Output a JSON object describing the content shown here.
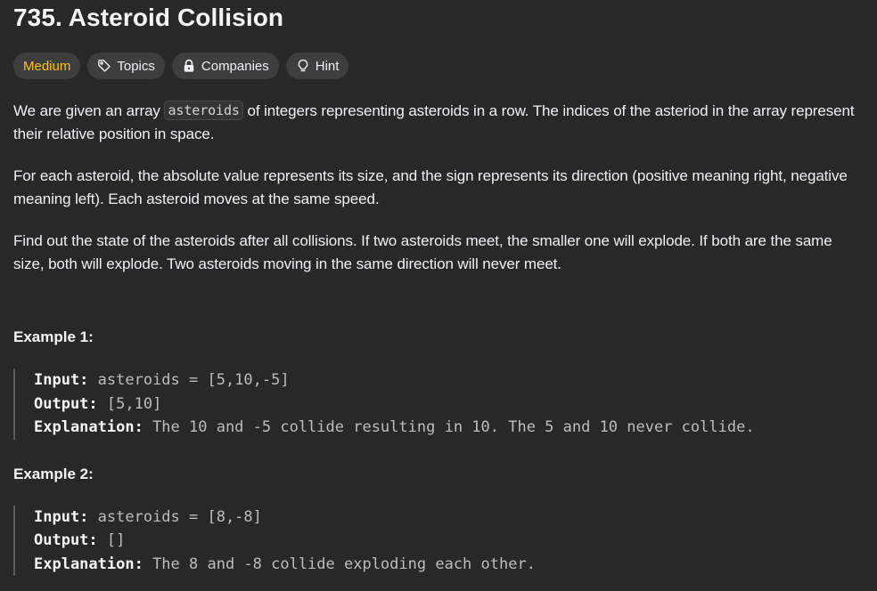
{
  "problem": {
    "title": "735. Asteroid Collision"
  },
  "tags": {
    "difficulty": "Medium",
    "topics": "Topics",
    "companies": "Companies",
    "hint": "Hint"
  },
  "description": {
    "p1_before": "We are given an array ",
    "p1_code": "asteroids",
    "p1_after": " of integers representing asteroids in a row. The indices of the asteriod in the array represent their relative position in space.",
    "p2": "For each asteroid, the absolute value represents its size, and the sign represents its direction (positive meaning right, negative meaning left). Each asteroid moves at the same speed.",
    "p3": "Find out the state of the asteroids after all collisions. If two asteroids meet, the smaller one will explode. If both are the same size, both will explode. Two asteroids moving in the same direction will never meet."
  },
  "examples": [
    {
      "title": "Example 1:",
      "input_label": "Input:",
      "input_value": " asteroids = [5,10,-5]",
      "output_label": "Output:",
      "output_value": " [5,10]",
      "explanation_label": "Explanation:",
      "explanation_value": " The 10 and -5 collide resulting in 10. The 5 and 10 never collide."
    },
    {
      "title": "Example 2:",
      "input_label": "Input:",
      "input_value": " asteroids = [8,-8]",
      "output_label": "Output:",
      "output_value": " []",
      "explanation_label": "Explanation:",
      "explanation_value": " The 8 and -8 collide exploding each other."
    }
  ],
  "icons": {
    "topics": "tag-icon",
    "companies": "lock-icon",
    "hint": "lightbulb-icon"
  },
  "colors": {
    "background": "#282828",
    "difficulty_medium": "#ffc01e",
    "tag_background": "#3e3e3e"
  }
}
